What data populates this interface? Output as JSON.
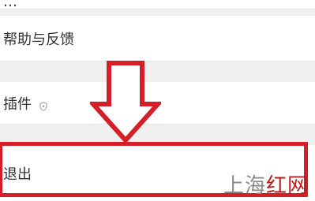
{
  "menu": {
    "top_partial_label": "…",
    "help_label": "帮助与反馈",
    "plugin_label": "插件",
    "plugin_icon": "shield-icon",
    "exit_label": "退出"
  },
  "annotation": {
    "arrow_color": "#d51f26",
    "highlight_color": "#d51f26"
  },
  "watermark": {
    "part1": "上海",
    "part2": "红网"
  }
}
